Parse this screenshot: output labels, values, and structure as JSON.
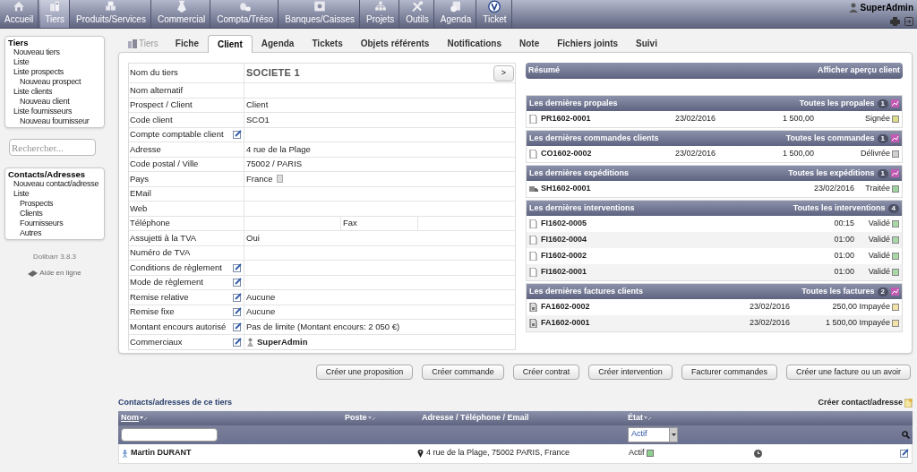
{
  "menu": [
    {
      "label": "Accueil",
      "kind": "home",
      "selected": false
    },
    {
      "label": "Tiers",
      "kind": "company",
      "selected": true
    },
    {
      "label": "Produits/Services",
      "kind": "box",
      "selected": false
    },
    {
      "label": "Commercial",
      "kind": "tie",
      "selected": false
    },
    {
      "label": "Compta/Tréso",
      "kind": "coins",
      "selected": false
    },
    {
      "label": "Banques/Caisses",
      "kind": "safe",
      "selected": false
    },
    {
      "label": "Projets",
      "kind": "tree",
      "selected": false
    },
    {
      "label": "Outils",
      "kind": "tools",
      "selected": false
    },
    {
      "label": "Agenda",
      "kind": "agenda",
      "selected": false
    },
    {
      "label": "Ticket",
      "kind": "ticket",
      "selected": false
    }
  ],
  "user": "SuperAdmin",
  "sidebar": [
    {
      "title": "Tiers",
      "items": [
        {
          "label": "Nouveau tiers"
        },
        {
          "label": "Liste"
        },
        {
          "label": "Liste prospects",
          "children": [
            {
              "label": "Nouveau prospect"
            }
          ]
        },
        {
          "label": "Liste clients",
          "children": [
            {
              "label": "Nouveau client"
            }
          ]
        },
        {
          "label": "Liste fournisseurs",
          "children": [
            {
              "label": "Nouveau fournisseur"
            }
          ]
        }
      ]
    },
    {
      "title": "Contacts/Adresses",
      "items": [
        {
          "label": "Nouveau contact/adresse"
        },
        {
          "label": "Liste",
          "children": [
            {
              "label": "Prospects"
            },
            {
              "label": "Clients"
            },
            {
              "label": "Fournisseurs"
            },
            {
              "label": "Autres"
            }
          ]
        }
      ]
    }
  ],
  "search": {
    "placeholder": "Rechercher..."
  },
  "version": "Dolibarr 3.8.3",
  "help": "Aide en ligne",
  "tabs": [
    {
      "label": "Tiers",
      "kind": "head",
      "selected": false
    },
    {
      "label": "Fiche",
      "selected": false
    },
    {
      "label": "Client",
      "selected": true
    },
    {
      "label": "Agenda",
      "selected": false
    },
    {
      "label": "Tickets",
      "selected": false
    },
    {
      "label": "Objets référents",
      "selected": false
    },
    {
      "label": "Notifications",
      "selected": false
    },
    {
      "label": "Note",
      "selected": false
    },
    {
      "label": "Fichiers joints",
      "selected": false
    },
    {
      "label": "Suivi",
      "selected": false
    }
  ],
  "fields": [
    {
      "label": "Nom du tiers",
      "value": "SOCIETE 1",
      "kind": "title",
      "button": ">"
    },
    {
      "label": "Nom alternatif",
      "kind": "text"
    },
    {
      "label": "Prospect / Client",
      "value": "Client",
      "kind": "text"
    },
    {
      "label": "Code client",
      "value": "SCO1",
      "kind": "text"
    },
    {
      "label": "Compte comptable client",
      "kind": "text",
      "editable": true
    },
    {
      "label": "Adresse",
      "value": "4 rue de la Plage",
      "kind": "text"
    },
    {
      "label": "Code postal / Ville",
      "value": "75002 / PARIS",
      "kind": "text"
    },
    {
      "label": "Pays",
      "value": "France",
      "kind": "country"
    },
    {
      "label": "EMail",
      "kind": "text"
    },
    {
      "label": "Web",
      "kind": "text"
    },
    {
      "label": "Téléphone",
      "kind": "pair",
      "label_2": "Fax"
    },
    {
      "label": "Assujetti à la TVA",
      "value": "Oui",
      "kind": "text"
    },
    {
      "label": "Numéro de TVA",
      "kind": "text"
    },
    {
      "label": "Conditions de règlement",
      "kind": "text",
      "editable": true
    },
    {
      "label": "Mode de règlement",
      "kind": "text",
      "editable": true
    },
    {
      "label": "Remise relative",
      "value": "Aucune",
      "kind": "text",
      "editable": true
    },
    {
      "label": "Remise fixe",
      "value": "Aucune",
      "kind": "text",
      "editable": true
    },
    {
      "label": "Montant encours autorisé",
      "value": "Pas de limite (Montant encours: 2 050 €)",
      "kind": "text",
      "editable": true
    },
    {
      "label": "Commerciaux",
      "value": "SuperAdmin",
      "kind": "user",
      "editable": true
    }
  ],
  "summary": {
    "title": "Résumé",
    "link": "Afficher aperçu client"
  },
  "sections": [
    {
      "title": "Les dernières propales",
      "link": "Toutes les propales",
      "count": "1",
      "stats": true,
      "kind": "proposal",
      "rows": [
        {
          "ref": "PR1602-0001",
          "date": "23/02/2016",
          "amount": "1 500,00",
          "status": "Signée",
          "color": "#dcdc8c"
        }
      ]
    },
    {
      "title": "Les dernières commandes clients",
      "link": "Toutes les commandes",
      "count": "1",
      "stats": true,
      "kind": "order",
      "rows": [
        {
          "ref": "CO1602-0002",
          "date": "23/02/2016",
          "amount": "1 500,00",
          "status": "Délivrée",
          "color": "#d0d0d0"
        }
      ]
    },
    {
      "title": "Les dernières expéditions",
      "link": "Toutes les expéditions",
      "count": "1",
      "stats": true,
      "kind": "shipment",
      "rows": [
        {
          "ref": "SH1602-0001",
          "date": "23/02/2016",
          "status": "Traitée",
          "color": "#9ed29e"
        }
      ]
    },
    {
      "title": "Les dernières interventions",
      "link": "Toutes les interventions",
      "count": "4",
      "stats": false,
      "kind": "intervention",
      "rows": [
        {
          "ref": "FI1602-0005",
          "duration": "00:15",
          "status": "Validé",
          "color": "#a8d8a8"
        },
        {
          "ref": "FI1602-0004",
          "duration": "01:00",
          "status": "Validé",
          "color": "#a8d8a8"
        },
        {
          "ref": "FI1602-0002",
          "duration": "01:00",
          "status": "Validé",
          "color": "#a8d8a8"
        },
        {
          "ref": "FI1602-0001",
          "duration": "01:00",
          "status": "Validé",
          "color": "#a8d8a8"
        }
      ]
    },
    {
      "title": "Les dernières factures clients",
      "link": "Toutes les factures",
      "count": "2",
      "stats": true,
      "kind": "invoice",
      "rows": [
        {
          "ref": "FA1602-0002",
          "date": "23/02/2016",
          "amount": "250,00",
          "status": "Impayée",
          "color": "#f2e2a8"
        },
        {
          "ref": "FA1602-0001",
          "date": "23/02/2016",
          "amount": "1 500,00",
          "status": "Impayée",
          "color": "#f2e2a8"
        }
      ]
    }
  ],
  "actions": [
    "Créer une proposition",
    "Créer commande",
    "Créer contrat",
    "Créer intervention",
    "Facturer commandes",
    "Créer une facture ou un avoir"
  ],
  "contacts": {
    "title": "Contacts/adresses de ce tiers",
    "create": "Créer contact/adresse",
    "columns": [
      {
        "label": "Nom",
        "sortable": true,
        "sorted": true
      },
      {
        "label": "Poste",
        "sortable": true,
        "sorted": false
      },
      {
        "label": "Adresse / Téléphone / Email",
        "sortable": false,
        "sorted": false
      },
      {
        "label": "État",
        "sortable": true,
        "sorted": false
      }
    ],
    "status_filter": "Actif",
    "rows": [
      {
        "name": "Martin DURANT",
        "address": "4 rue de la Plage, 75002 PARIS, France",
        "status": "Actif",
        "color": "#8fcf8f"
      }
    ]
  }
}
